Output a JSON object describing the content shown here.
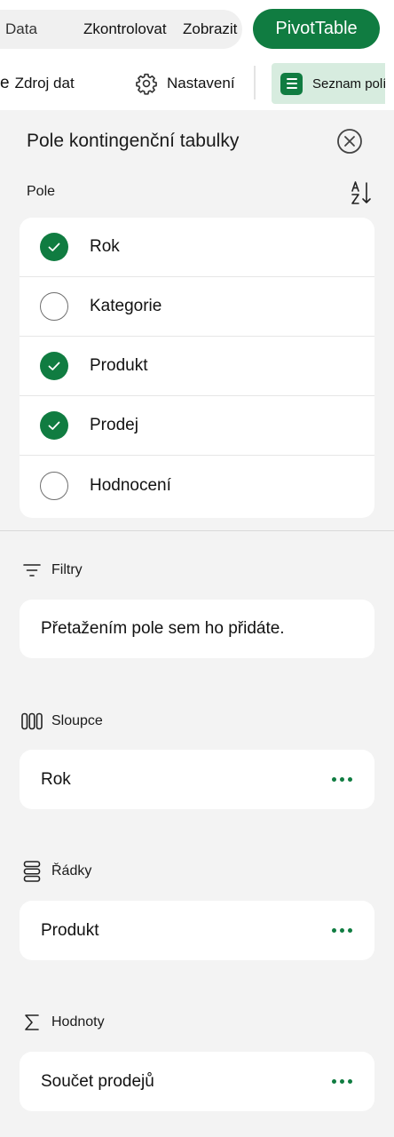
{
  "ribbon": {
    "tabs": [
      {
        "label": "Data"
      },
      {
        "label": "Zkontrolovat"
      },
      {
        "label": "Zobrazit"
      }
    ],
    "active_tab": "PivotTable",
    "accent": "#107c41"
  },
  "toolbar": {
    "truncated_lead": "e",
    "source_label": "Zdroj dat",
    "settings_label": "Nastavení",
    "field_list_label": "Seznam polí"
  },
  "panel": {
    "title": "Pole kontingenční tabulky",
    "fields_label": "Pole",
    "fields": [
      {
        "label": "Rok",
        "checked": true
      },
      {
        "label": "Kategorie",
        "checked": false
      },
      {
        "label": "Produkt",
        "checked": true
      },
      {
        "label": "Prodej",
        "checked": true
      },
      {
        "label": "Hodnocení",
        "checked": false
      }
    ]
  },
  "areas": {
    "filters": {
      "label": "Filtry",
      "placeholder": "Přetažením pole sem ho přidáte."
    },
    "columns": {
      "label": "Sloupce",
      "items": [
        "Rok"
      ]
    },
    "rows": {
      "label": "Řádky",
      "items": [
        "Produkt"
      ]
    },
    "values": {
      "label": "Hodnoty",
      "items": [
        "Součet prodejů"
      ]
    }
  }
}
